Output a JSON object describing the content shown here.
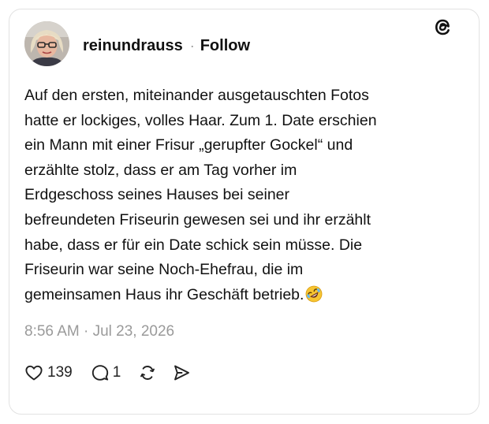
{
  "post": {
    "username": "reinundrauss",
    "separator": "·",
    "follow_label": "Follow",
    "text": "Auf den ersten, miteinander ausgetauschten Fotos\nhatte er lockiges, volles Haar. Zum 1. Date erschien\nein Mann mit einer Frisur „gerupfter Gockel“ und\nerzählte stolz, dass er am Tag vorher im\nErdgeschoss seines Hauses bei seiner\nbefreundeten Friseurin gewesen sei und ihr erzählt\nhabe, dass er für ein Date schick sein müsse. Die\nFriseurin war seine Noch-Ehefrau, die im\ngemeinsamen Haus ihr Geschäft betrieb.",
    "emoji": "rolling-on-floor-laughing",
    "timestamp": "8:56 AM · Jul 23, 2026"
  },
  "actions": {
    "like_count": "139",
    "reply_count": "1"
  },
  "icons": {
    "logo": "threads-logo-icon",
    "like": "heart-icon",
    "reply": "comment-bubble-icon",
    "repost": "repost-icon",
    "share": "send-icon"
  },
  "colors": {
    "text": "#111111",
    "muted": "#9a9a9a",
    "border": "#e2e2e2"
  }
}
